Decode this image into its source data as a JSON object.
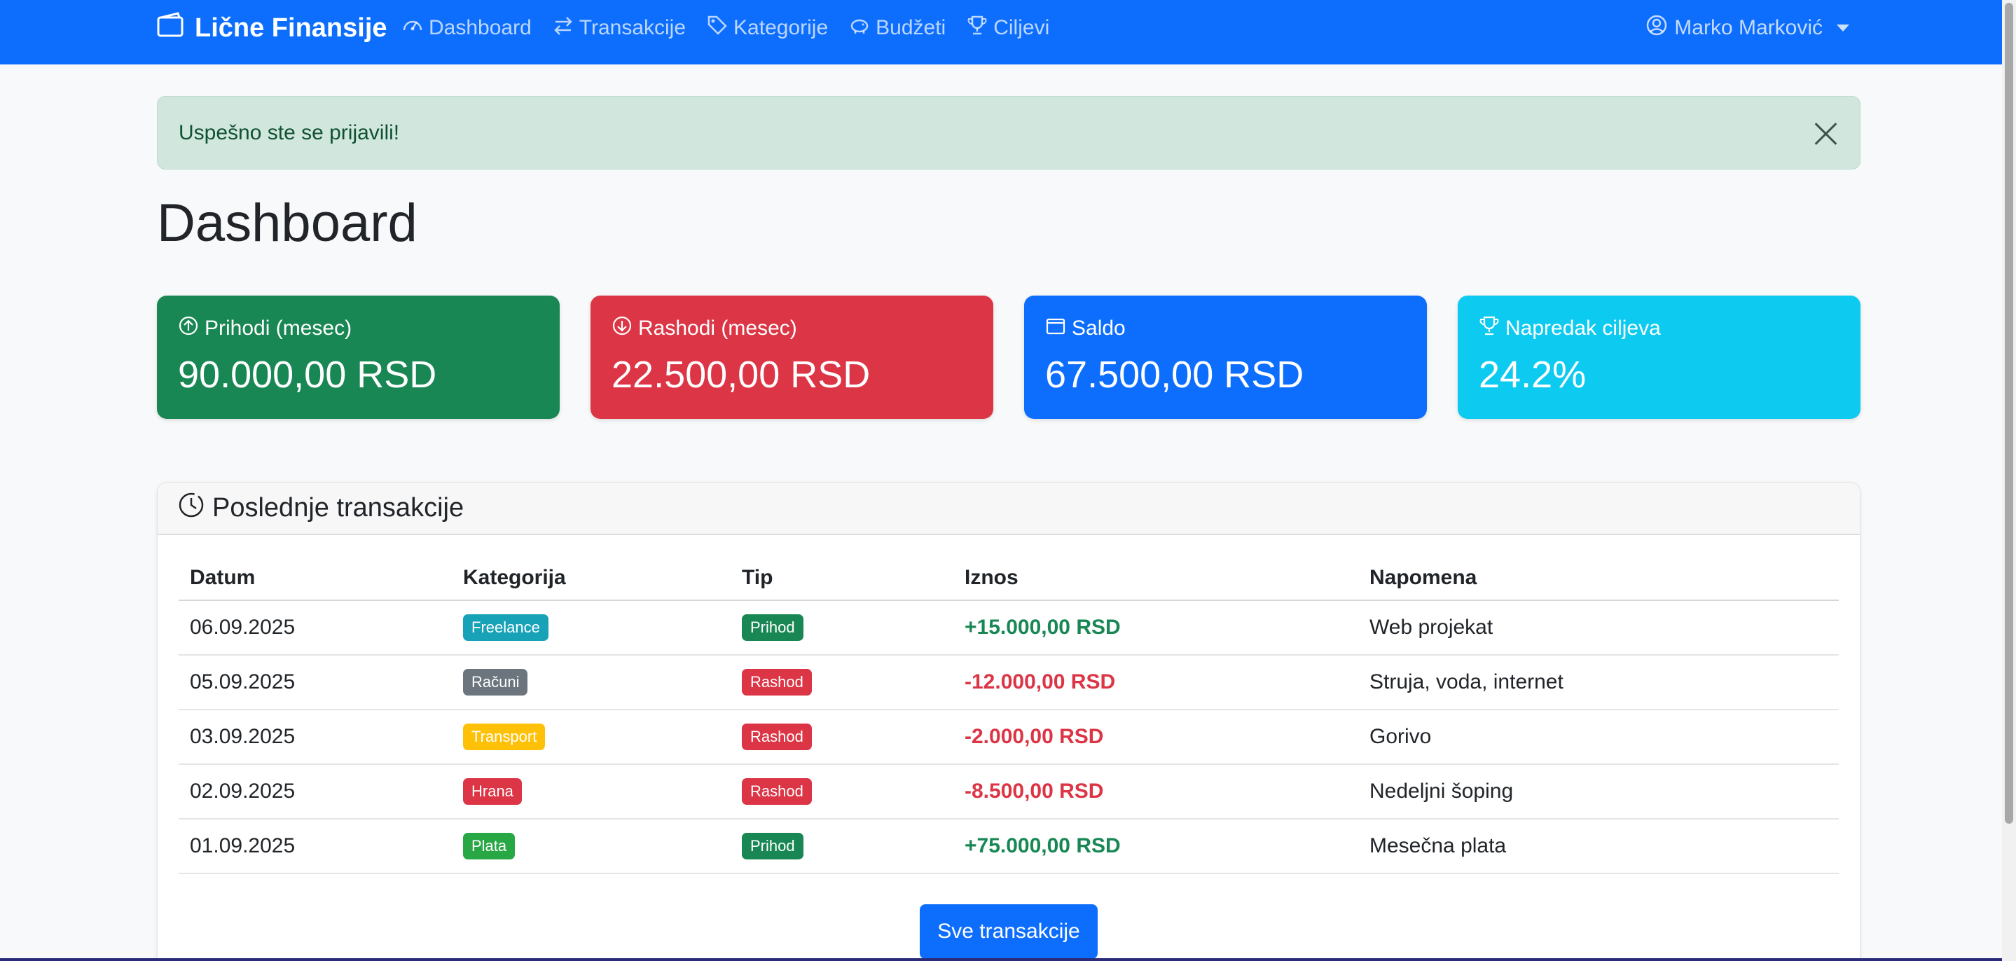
{
  "navbar": {
    "brand": "Lične Finansije",
    "links": [
      {
        "label": "Dashboard",
        "icon": "speedometer-icon"
      },
      {
        "label": "Transakcije",
        "icon": "arrow-left-right-icon"
      },
      {
        "label": "Kategorije",
        "icon": "tags-icon"
      },
      {
        "label": "Budžeti",
        "icon": "piggy-bank-icon"
      },
      {
        "label": "Ciljevi",
        "icon": "trophy-icon"
      }
    ],
    "user": "Marko Marković"
  },
  "alert": {
    "message": "Uspešno ste se prijavili!"
  },
  "page": {
    "title": "Dashboard"
  },
  "stats": [
    {
      "label": "Prihodi (mesec)",
      "value": "90.000,00 RSD",
      "icon": "arrow-up-circle-icon",
      "color": "#198754"
    },
    {
      "label": "Rashodi (mesec)",
      "value": "22.500,00 RSD",
      "icon": "arrow-down-circle-icon",
      "color": "#dc3545"
    },
    {
      "label": "Saldo",
      "value": "67.500,00 RSD",
      "icon": "wallet-icon",
      "color": "#0d6efd"
    },
    {
      "label": "Napredak ciljeva",
      "value": "24.2%",
      "icon": "trophy-icon",
      "color": "#0dcaf0"
    }
  ],
  "transactions": {
    "title": "Poslednje transakcije",
    "columns": [
      "Datum",
      "Kategorija",
      "Tip",
      "Iznos",
      "Napomena"
    ],
    "rows": [
      {
        "date": "06.09.2025",
        "category": "Freelance",
        "category_color": "#17a2b8",
        "type": "Prihod",
        "amount": "+15.000,00 RSD",
        "note": "Web projekat"
      },
      {
        "date": "05.09.2025",
        "category": "Računi",
        "category_color": "#6c757d",
        "type": "Rashod",
        "amount": "-12.000,00 RSD",
        "note": "Struja, voda, internet"
      },
      {
        "date": "03.09.2025",
        "category": "Transport",
        "category_color": "#ffc107",
        "type": "Rashod",
        "amount": "-2.000,00 RSD",
        "note": "Gorivo"
      },
      {
        "date": "02.09.2025",
        "category": "Hrana",
        "category_color": "#dc3545",
        "type": "Rashod",
        "amount": "-8.500,00 RSD",
        "note": "Nedeljni šoping"
      },
      {
        "date": "01.09.2025",
        "category": "Plata",
        "category_color": "#28a745",
        "type": "Prihod",
        "amount": "+75.000,00 RSD",
        "note": "Mesečna plata"
      }
    ],
    "button": "Sve transakcije"
  }
}
